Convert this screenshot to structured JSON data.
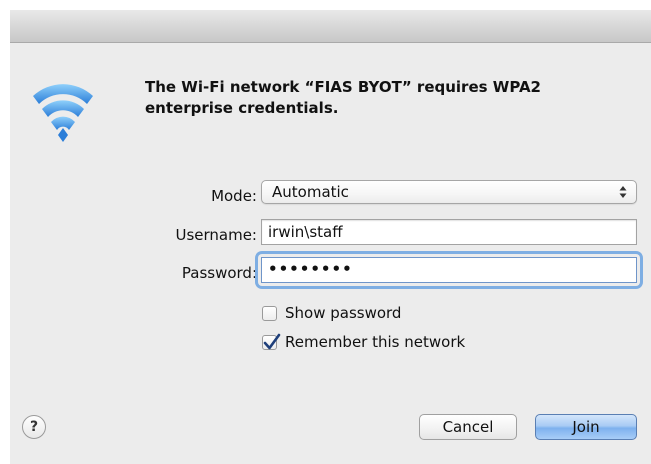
{
  "dialog": {
    "message": "The Wi-Fi network “FIAS BYOT” requires WPA2 enterprise credentials."
  },
  "form": {
    "mode_label": "Mode:",
    "mode_value": "Automatic",
    "username_label": "Username:",
    "username_value": "irwin\\staff",
    "password_label": "Password:",
    "password_value": "••••••••"
  },
  "options": {
    "show_password_label": "Show password",
    "show_password_checked": false,
    "remember_label": "Remember this network",
    "remember_checked": true
  },
  "buttons": {
    "help_label": "?",
    "cancel_label": "Cancel",
    "join_label": "Join"
  },
  "icons": {
    "wifi": "wifi-icon",
    "popup_arrows": "up-down-arrows-icon",
    "checkmark": "checkmark-icon"
  },
  "colors": {
    "wifi_blue": "#3b8fe0",
    "focus_ring": "#7eaee3",
    "default_button": "#7eb1ee"
  }
}
